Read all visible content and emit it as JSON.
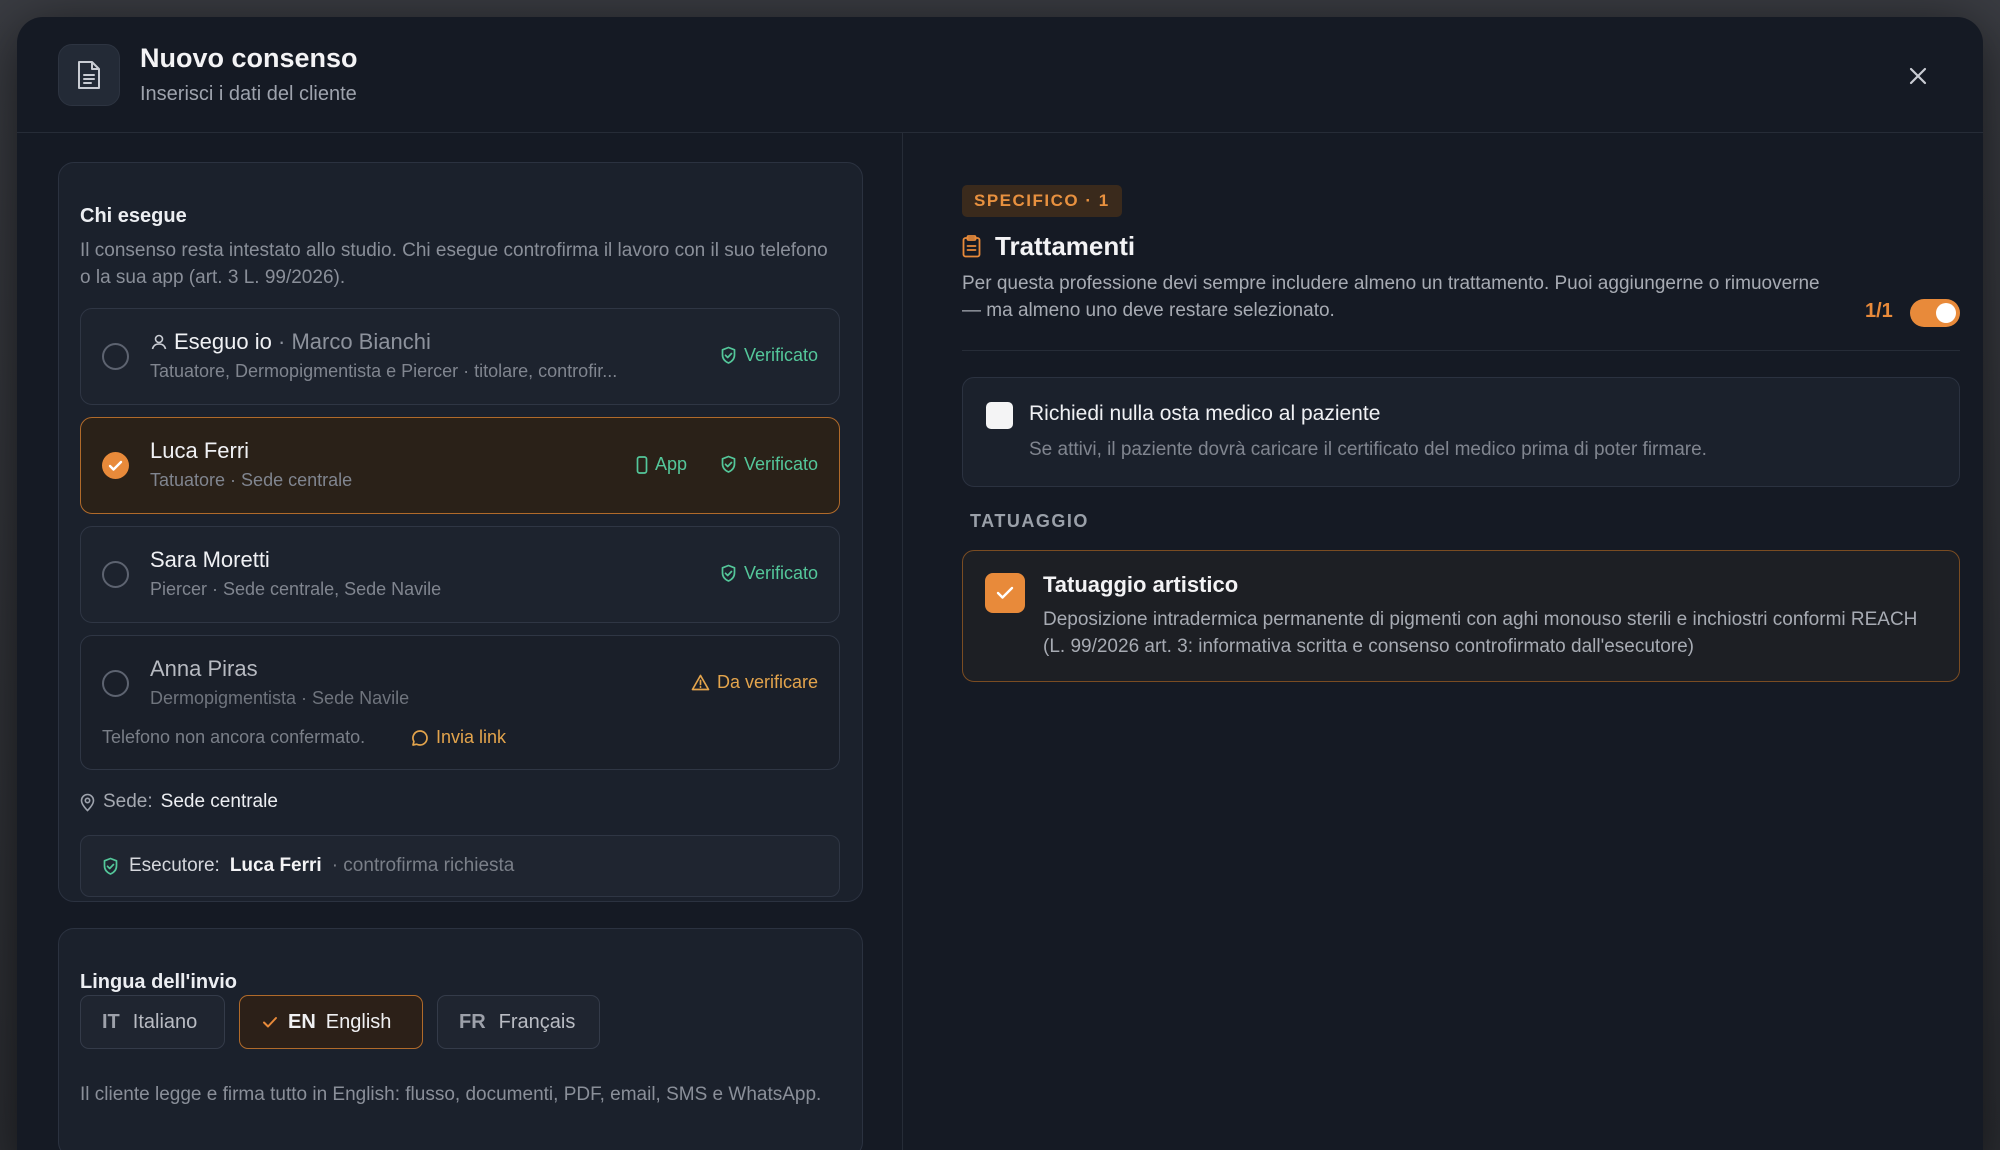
{
  "modal": {
    "title": "Nuovo consenso",
    "subtitle": "Inserisci i dati del cliente"
  },
  "executor_card": {
    "title": "Chi esegue",
    "description": "Il consenso resta intestato allo studio. Chi esegue controfirma il lavoro con il suo telefono o la sua app (art. 3 L. 99/2026).",
    "people": [
      {
        "name": "Eseguo io",
        "extra": "Marco Bianchi",
        "role": "Tatuatore, Dermopigmentista e Piercer · titolare, controfir...",
        "status": "Verificato",
        "selected": false
      },
      {
        "name": "Luca Ferri",
        "role": "Tatuatore · Sede centrale",
        "app": "App",
        "status": "Verificato",
        "selected": true
      },
      {
        "name": "Sara Moretti",
        "role": "Piercer · Sede centrale, Sede Navile",
        "status": "Verificato",
        "selected": false
      },
      {
        "name": "Anna Piras",
        "role": "Dermopigmentista · Sede Navile",
        "status": "Da verificare",
        "selected": false,
        "note": "Telefono non ancora confermato.",
        "link": "Invia link"
      }
    ],
    "location_label": "Sede:",
    "location_value": "Sede centrale",
    "executor_label": "Esecutore:",
    "executor_value": "Luca Ferri",
    "executor_note": "· controfirma richiesta"
  },
  "language_card": {
    "title": "Lingua dell'invio",
    "options": [
      {
        "code": "IT",
        "label": "Italiano",
        "selected": false
      },
      {
        "code": "EN",
        "label": "English",
        "selected": true
      },
      {
        "code": "FR",
        "label": "Français",
        "selected": false
      }
    ],
    "description": "Il cliente legge e firma tutto in English: flusso, documenti, PDF, email, SMS e WhatsApp."
  },
  "treatments": {
    "pill": "SPECIFICO · 1",
    "title": "Trattamenti",
    "description": "Per questa professione devi sempre includere almeno un trattamento. Puoi aggiungerne o rimuoverne — ma almeno uno deve restare selezionato.",
    "count": "1/1",
    "toggle_on": true,
    "medical": {
      "title": "Richiedi nulla osta medico al paziente",
      "description": "Se attivi, il paziente dovrà caricare il certificato del medico prima di poter firmare.",
      "checked": false
    },
    "section": "TATUAGGIO",
    "item": {
      "title": "Tatuaggio artistico",
      "description": "Deposizione intradermica permanente di pigmenti con aghi monouso sterili e inchiostri conformi REACH (L. 99/2026 art. 3: informativa scritta e consenso controfirmato dall'esecutore)",
      "checked": true
    }
  },
  "colors": {
    "accent": "#e88a3a",
    "verified": "#54c79a",
    "warning": "#e3a44c",
    "surface": "#151a24"
  }
}
